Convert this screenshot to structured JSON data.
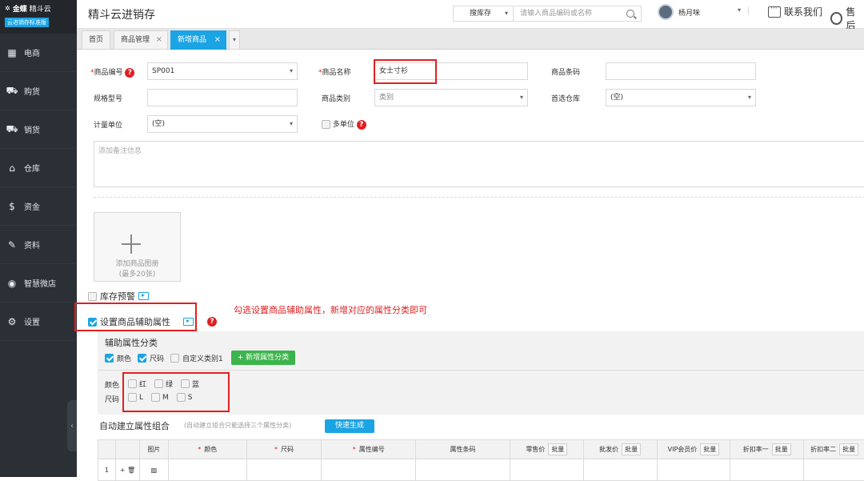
{
  "sidebar": {
    "brand": "金蝶",
    "product": "精斗云",
    "edition": "云进销存标准版",
    "items": [
      {
        "label": "电商",
        "icon": "store-icon"
      },
      {
        "label": "购货",
        "icon": "cart-icon"
      },
      {
        "label": "销货",
        "icon": "sales-cart-icon"
      },
      {
        "label": "仓库",
        "icon": "warehouse-icon"
      },
      {
        "label": "资金",
        "icon": "money-icon"
      },
      {
        "label": "资料",
        "icon": "pencil-icon"
      },
      {
        "label": "智慧微店",
        "icon": "shop-icon"
      },
      {
        "label": "设置",
        "icon": "gear-icon"
      }
    ],
    "collapse": "‹"
  },
  "header": {
    "app_title": "精斗云进销存",
    "search_scope": "搜库存",
    "search_placeholder": "请输入商品编码或名称",
    "username": "杨月咪",
    "contact": "联系我们",
    "after_sales": "售后"
  },
  "tabs": [
    {
      "label": "首页"
    },
    {
      "label": "商品管理"
    },
    {
      "label": "新增商品"
    }
  ],
  "form": {
    "code_label": "商品编号",
    "code_value": "SP001",
    "name_label": "商品名称",
    "name_value": "女士寸衫",
    "barcode_label": "商品条码",
    "barcode_value": "",
    "spec_label": "规格型号",
    "spec_value": "",
    "category_label": "商品类别",
    "category_value": "类别",
    "warehouse_label": "首选仓库",
    "warehouse_value": "(空)",
    "unit_label": "计量单位",
    "unit_value": "(空)",
    "multi_unit_label": "多单位",
    "memo_placeholder": "添加备注信息",
    "image_add_line1": "添加商品图册",
    "image_add_line2": "(最多20张)",
    "stock_alert_label": "库存预警",
    "aux_attr_label": "设置商品辅助属性"
  },
  "annotation": "勾选设置商品辅助属性，新增对应的属性分类即可",
  "attr_panel": {
    "title": "辅助属性分类",
    "categories": [
      {
        "label": "颜色",
        "checked": true
      },
      {
        "label": "尺码",
        "checked": true
      },
      {
        "label": "自定义类别1",
        "checked": false
      }
    ],
    "add_button": "+ 新增属性分类",
    "color_label": "颜色",
    "colors": [
      "红",
      "绿",
      "蓝"
    ],
    "size_label": "尺码",
    "sizes": [
      "L",
      "M",
      "S"
    ]
  },
  "combo": {
    "title": "自动建立属性组合",
    "hint": "(自动建立组合只能选择三个属性分类)",
    "generate_button": "快速生成"
  },
  "table": {
    "columns": [
      {
        "label": "",
        "required": false,
        "batch": false
      },
      {
        "label": "",
        "required": false,
        "batch": false
      },
      {
        "label": "图片",
        "required": false,
        "batch": false
      },
      {
        "label": "颜色",
        "required": true,
        "batch": false
      },
      {
        "label": "尺码",
        "required": true,
        "batch": false
      },
      {
        "label": "属性编号",
        "required": true,
        "batch": false
      },
      {
        "label": "属性条码",
        "required": false,
        "batch": false
      },
      {
        "label": "零售价",
        "required": false,
        "batch": true
      },
      {
        "label": "批发价",
        "required": false,
        "batch": true
      },
      {
        "label": "VIP会员价",
        "required": false,
        "batch": true
      },
      {
        "label": "折扣率一",
        "required": false,
        "batch": true
      },
      {
        "label": "折扣率二",
        "required": false,
        "batch": true
      }
    ],
    "batch_label": "批量",
    "row_number": "1",
    "row_actions": "+ 🗑"
  },
  "colors": {
    "accent": "#1ba4e4",
    "sidebar_bg": "#2b3036",
    "required": "#e02020",
    "green_button": "#3cb44b"
  }
}
